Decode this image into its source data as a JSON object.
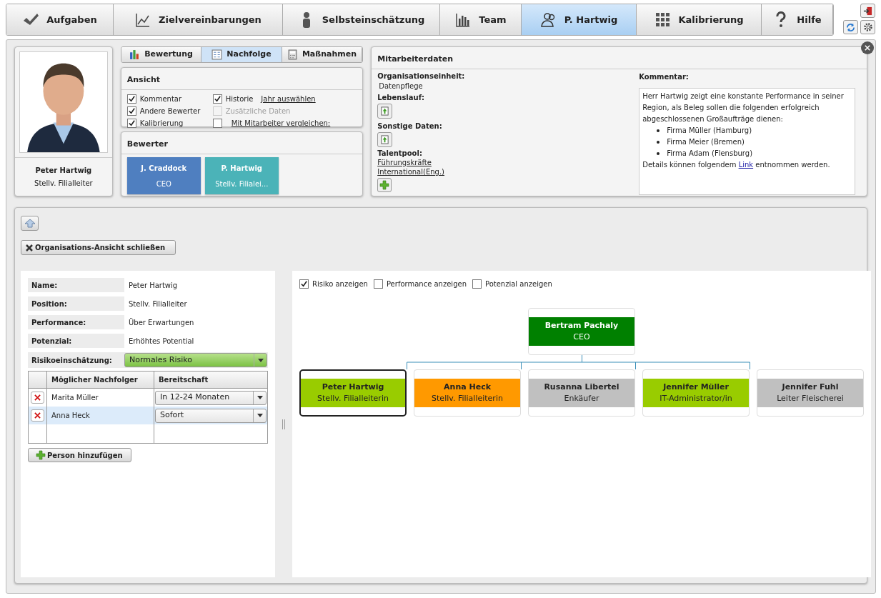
{
  "nav": {
    "tabs": [
      {
        "label": "Aufgaben",
        "selected": false
      },
      {
        "label": "Zielvereinbarungen",
        "selected": false
      },
      {
        "label": "Selbsteinschätzung",
        "selected": false
      },
      {
        "label": "Team",
        "selected": false
      },
      {
        "label": "P. Hartwig",
        "selected": true
      },
      {
        "label": "Kalibrierung",
        "selected": false
      },
      {
        "label": "Hilfe",
        "selected": false
      }
    ]
  },
  "profile": {
    "name": "Peter Hartwig",
    "position": "Stellv. Filialleiter"
  },
  "subtabs": [
    {
      "label": "Bewertung",
      "selected": false
    },
    {
      "label": "Nachfolge",
      "selected": true
    },
    {
      "label": "Maßnahmen",
      "selected": false
    }
  ],
  "ansicht": {
    "title": "Ansicht",
    "options": [
      {
        "label": "Kommentar",
        "checked": true,
        "disabled": false
      },
      {
        "label": "Historie",
        "checked": true,
        "disabled": false,
        "link": "Jahr auswählen"
      },
      {
        "label": "Andere Bewerter",
        "checked": true,
        "disabled": false
      },
      {
        "label": "Zusätzliche Daten",
        "checked": false,
        "disabled": true
      },
      {
        "label": "Kalibrierung",
        "checked": true,
        "disabled": false
      },
      {
        "label": "Mit Mitarbeiter vergleichen:",
        "checked": false,
        "disabled": false,
        "kind": "link"
      }
    ]
  },
  "bewerter": {
    "title": "Bewerter",
    "items": [
      {
        "name": "J. Craddock",
        "role": "CEO",
        "color": "#4f7fc0"
      },
      {
        "name": "P. Hartwig",
        "role": "Stellv. Filialei...",
        "color": "#4bb3b8"
      }
    ]
  },
  "mitarbeiterdaten": {
    "title": "Mitarbeiterdaten",
    "org_label": "Organisationseinheit:",
    "org_value": "Datenpflege",
    "lebenslauf": "Lebenslauf:",
    "sonstige": "Sonstige Daten:",
    "talentpool": "Talentpool:",
    "talent_links": [
      "Führungskräfte",
      "International(Eng.)"
    ],
    "kommentar_label": "Kommentar:",
    "kommentar_intro": "Herr Hartwig zeigt eine konstante Performance in seiner Region, als Beleg sollen die folgenden erfolgreich abgeschlossenen Großaufträge dienen:",
    "kommentar_items": [
      "Firma Müller (Hamburg)",
      "Firma Meier (Bremen)",
      "Firma Adam (Flensburg)"
    ],
    "kommentar_before": "Details können folgendem",
    "kommentar_link": "Link",
    "kommentar_after": "entnommen werden."
  },
  "close_org_button": "Organisations-Ansicht schließen",
  "details": [
    {
      "label": "Name:",
      "value": "Peter Hartwig"
    },
    {
      "label": "Position:",
      "value": "Stellv. Filialleiter"
    },
    {
      "label": "Performance:",
      "value": "Über Erwartungen"
    },
    {
      "label": "Potenzial:",
      "value": "Erhöhtes Potential"
    }
  ],
  "risk": {
    "label": "Risikoeinschätzung:",
    "value": "Normales Risiko"
  },
  "successors": {
    "columns": [
      "Möglicher Nachfolger",
      "Bereitschaft"
    ],
    "rows": [
      {
        "name": "Marita Müller",
        "readiness": "In 12-24 Monaten",
        "selected": false
      },
      {
        "name": "Anna Heck",
        "readiness": "Sofort",
        "selected": true
      }
    ]
  },
  "add_person_button": "Person hinzufügen",
  "chart_options": [
    {
      "label": "Risiko anzeigen",
      "checked": true
    },
    {
      "label": "Performance anzeigen",
      "checked": false
    },
    {
      "label": "Potenzial anzeigen",
      "checked": false
    }
  ],
  "org_chart": {
    "root": {
      "name": "Bertram Pachaly",
      "role": "CEO",
      "color": "#008000"
    },
    "children": [
      {
        "name": "Peter Hartwig",
        "role": "Stellv. Filialleiterin",
        "color": "#99cc00",
        "selected": true
      },
      {
        "name": "Anna Heck",
        "role": "Stellv. Filialleiterin",
        "color": "#ff9900",
        "selected": false
      },
      {
        "name": "Rusanna Libertel",
        "role": "Enkäufer",
        "color": "#c0c0c0",
        "selected": false
      },
      {
        "name": "Jennifer Müller",
        "role": "IT-Administrator/in",
        "color": "#99cc00",
        "selected": false
      },
      {
        "name": "Jennifer Fuhl",
        "role": "Leiter Fleischerei",
        "color": "#c0c0c0",
        "selected": false
      }
    ]
  }
}
